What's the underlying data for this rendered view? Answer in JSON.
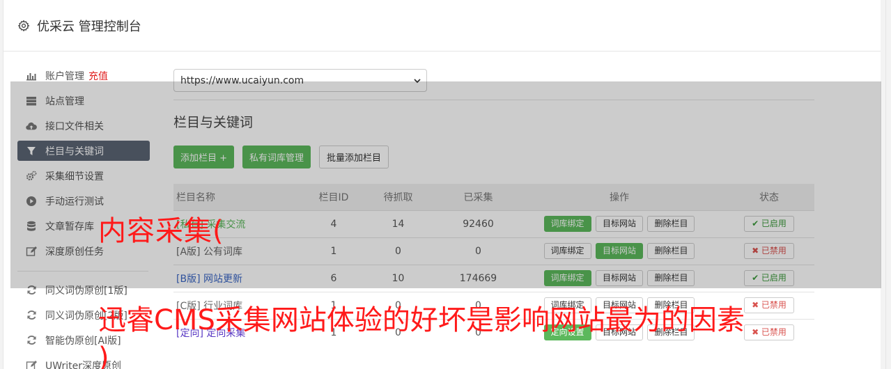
{
  "header": {
    "title": "优采云 管理控制台"
  },
  "sidebar": {
    "items": [
      {
        "label": "账户管理",
        "extra": "充值",
        "icon": "bar-chart-icon"
      },
      {
        "label": "站点管理",
        "icon": "server-icon"
      },
      {
        "label": "接口文件相关",
        "icon": "cloud-upload-icon"
      },
      {
        "label": "栏目与关键词",
        "icon": "filter-icon",
        "active": true
      },
      {
        "label": "采集细节设置",
        "icon": "gears-icon"
      },
      {
        "label": "手动运行测试",
        "icon": "play-circle-icon"
      },
      {
        "label": "文章暂存库",
        "icon": "database-icon"
      },
      {
        "label": "深度原创任务",
        "icon": "edit-icon"
      }
    ],
    "items2": [
      {
        "label": "同义词伪原创[1版]",
        "icon": "refresh-icon"
      },
      {
        "label": "同义词伪原创[2版]",
        "icon": "refresh-icon"
      },
      {
        "label": "智能伪原创[AI版]",
        "icon": "refresh-icon"
      },
      {
        "label": "UWriter深度原创",
        "icon": "edit-icon"
      }
    ]
  },
  "main": {
    "site_select_value": "https://www.ucaiyun.com",
    "section_title": "栏目与关键词",
    "buttons": {
      "add": "添加栏目 +",
      "private_lib": "私有词库管理",
      "batch_add": "批量添加栏目"
    },
    "table": {
      "headers": [
        "栏目名称",
        "栏目ID",
        "待抓取",
        "已采集",
        "操作",
        "状态"
      ],
      "rows": [
        {
          "tag": "[私有]",
          "name": "采集交流",
          "id": "4",
          "pending": "14",
          "collected": "92460",
          "op1": "词库绑定",
          "op2": "目标网站",
          "op3": "删除栏目",
          "status": "✔ 已启用"
        },
        {
          "tag": "[A版]",
          "name": "公有词库",
          "id": "1",
          "pending": "0",
          "collected": "0",
          "op1": "词库绑定",
          "op2": "目标网站",
          "op3": "删除栏目",
          "status": "✖ 已禁用"
        },
        {
          "tag": "[B版]",
          "name": "网站更新",
          "id": "6",
          "pending": "10",
          "collected": "174669",
          "op1": "词库绑定",
          "op2": "目标网站",
          "op3": "删除栏目",
          "status": "✔ 已启用"
        },
        {
          "tag": "[C版]",
          "name": "行业词库",
          "id": "1",
          "pending": "0",
          "collected": "0",
          "op1": "词库绑定",
          "op2": "目标网站",
          "op3": "删除栏目",
          "status": "✖ 已禁用"
        },
        {
          "tag": "[定向]",
          "name": "定向采集",
          "id": "1",
          "pending": "0",
          "collected": "0",
          "op1": "定向设置",
          "op2": "目标网站",
          "op3": "删除栏目",
          "status": "✖ 已禁用"
        }
      ]
    }
  },
  "watermark": {
    "line1": "内容采集(",
    "line2": "迅睿CMS采集网站体验的好坏是影响网站最为的因素",
    "line3": ")"
  }
}
